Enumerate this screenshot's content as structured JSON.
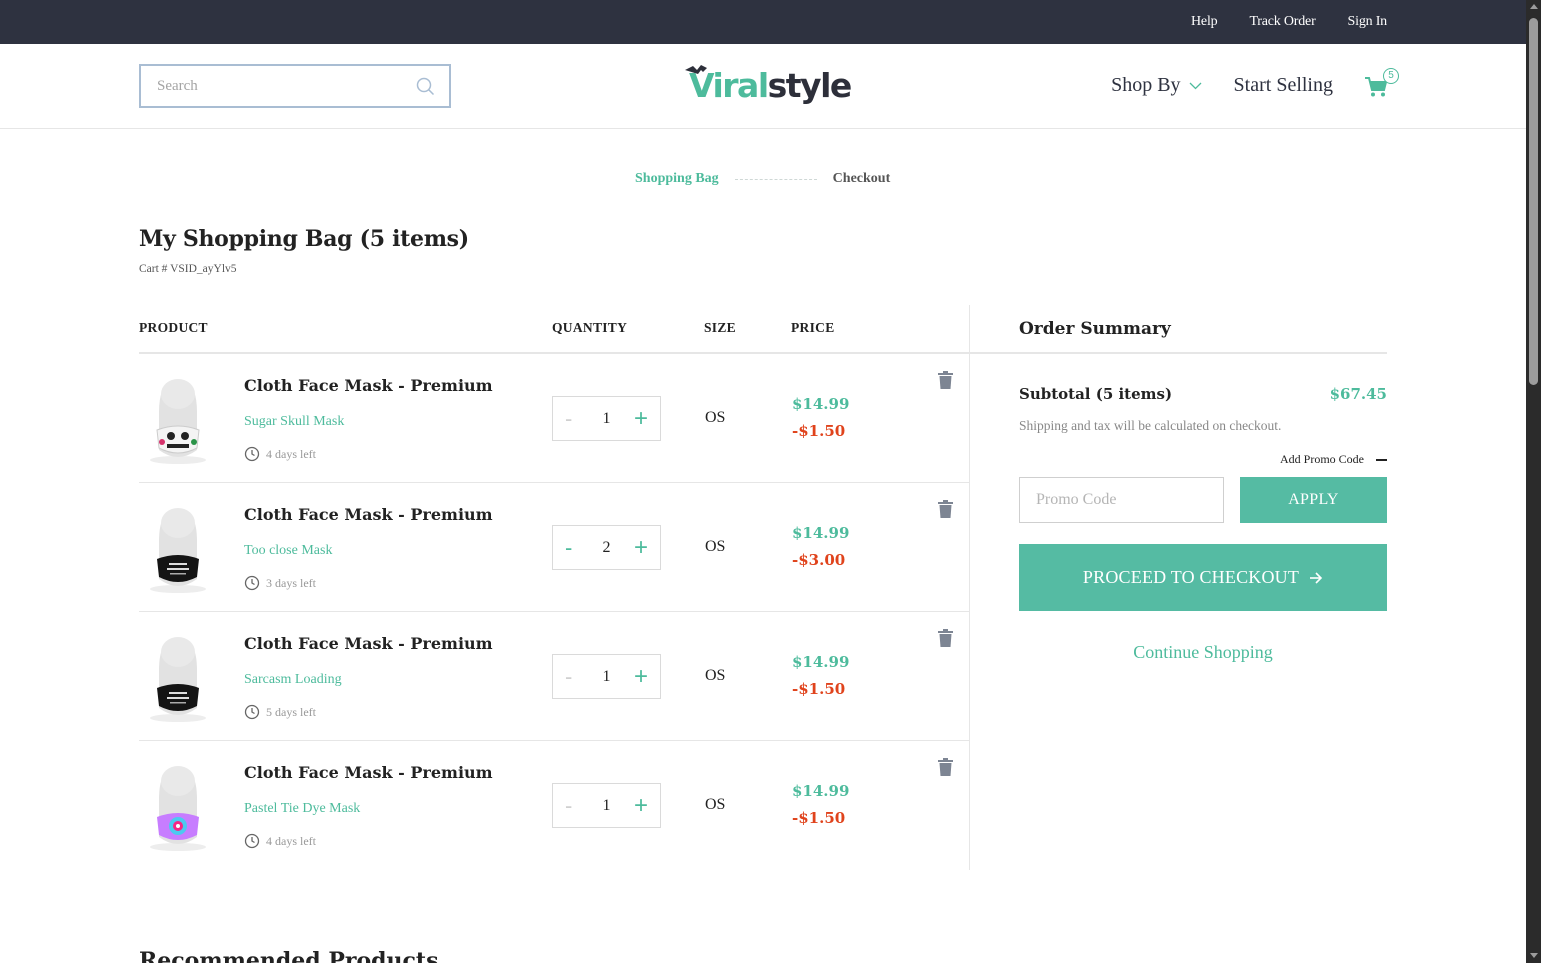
{
  "topbar": {
    "links": [
      "Help",
      "Track Order",
      "Sign In"
    ]
  },
  "header": {
    "search_placeholder": "Search",
    "logo_text_v": "V",
    "logo_text_rest_1": "iral",
    "logo_text_rest_2": "style",
    "nav": {
      "shop_by": "Shop By",
      "start_selling": "Start Selling"
    },
    "cart_count": "5"
  },
  "steps": {
    "active": "Shopping Bag",
    "next": "Checkout"
  },
  "bag": {
    "title": "My Shopping Bag (5 items)",
    "cart_id": "Cart # VSID_ayYlv5"
  },
  "table": {
    "headers": {
      "product": "PRODUCT",
      "quantity": "QUANTITY",
      "size": "SIZE",
      "price": "PRICE"
    },
    "rows": [
      {
        "name": "Cloth Face Mask - Premium",
        "design": "Sugar Skull Mask",
        "days": "4 days left",
        "qty": "1",
        "minus": "-",
        "plus": "+",
        "size": "OS",
        "price": "$14.99",
        "discount": "-$1.50",
        "mask": "skull"
      },
      {
        "name": "Cloth Face Mask - Premium",
        "design": "Too close Mask",
        "days": "3 days left",
        "qty": "2",
        "minus": "-",
        "plus": "+",
        "size": "OS",
        "price": "$14.99",
        "discount": "-$3.00",
        "mask": "black"
      },
      {
        "name": "Cloth Face Mask - Premium",
        "design": "Sarcasm Loading",
        "days": "5 days left",
        "qty": "1",
        "minus": "-",
        "plus": "+",
        "size": "OS",
        "price": "$14.99",
        "discount": "-$1.50",
        "mask": "black"
      },
      {
        "name": "Cloth Face Mask - Premium",
        "design": "Pastel Tie Dye Mask",
        "days": "4 days left",
        "qty": "1",
        "minus": "-",
        "plus": "+",
        "size": "OS",
        "price": "$14.99",
        "discount": "-$1.50",
        "mask": "tiedye"
      }
    ]
  },
  "summary": {
    "title": "Order Summary",
    "subtotal_label": "Subtotal (5 items)",
    "subtotal_value": "$67.45",
    "shipping_note": "Shipping and tax will be calculated on checkout.",
    "promo_toggle": "Add Promo Code",
    "promo_placeholder": "Promo Code",
    "apply": "APPLY",
    "checkout": "PROCEED TO CHECKOUT",
    "continue": "Continue Shopping"
  },
  "recommended": "Recommended Products",
  "colors": {
    "accent": "#4dbb9c",
    "button": "#55bba3",
    "discount": "#e0431c",
    "topbar": "#2e3240"
  }
}
